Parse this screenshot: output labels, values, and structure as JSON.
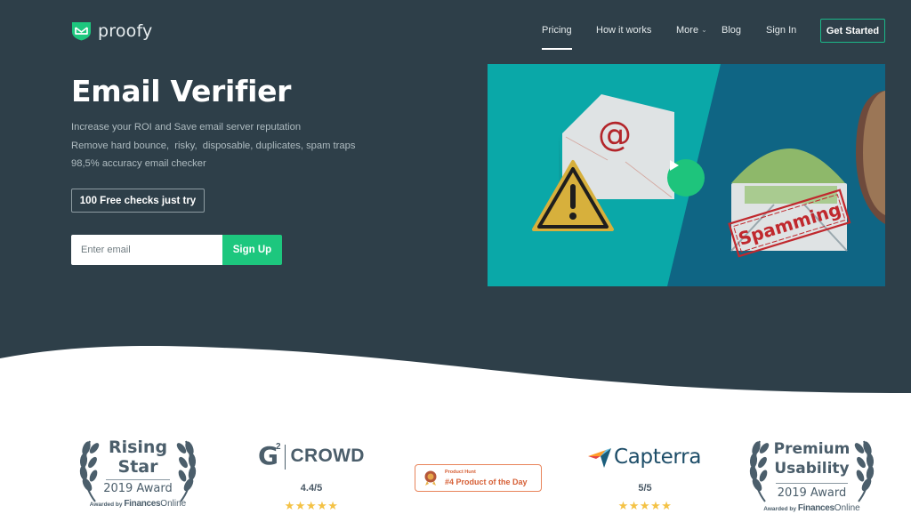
{
  "brand": {
    "name": "proofy",
    "accent": "#1dc77e",
    "hero_bg": "#2e3f49"
  },
  "nav": {
    "items": [
      {
        "label": "Pricing",
        "active": true
      },
      {
        "label": "How it works",
        "active": false
      },
      {
        "label": "More",
        "active": false,
        "has_dropdown": true
      },
      {
        "label": "Blog",
        "active": false
      },
      {
        "label": "Sign In",
        "active": false
      }
    ],
    "cta": "Get Started"
  },
  "hero": {
    "title": "Email Verifier",
    "lines": [
      "Increase your ROI and Save email server reputation",
      "Remove hard bounce,  risky,  disposable, duplicates, spam traps",
      "98,5% accuracy email checker"
    ],
    "free_checks_label": "100 Free checks just try",
    "email_placeholder": "Enter email",
    "email_value": "",
    "signup_label": "Sign Up"
  },
  "video": {
    "left_icon": "at-sign-envelope",
    "warning_icon": "warning-triangle",
    "stamp_text": "Spamming",
    "play_icon": "play-icon"
  },
  "awards": {
    "rising_star": {
      "title_line1": "Rising",
      "title_line2": "Star",
      "year": "2019 Award",
      "awarded_by": "Awarded by",
      "org_bold": "Finances",
      "org_light": "Online"
    },
    "g2crowd": {
      "logo_g": "G",
      "logo_sup": "2",
      "logo_text": "CROWD",
      "rating": "4.4/5",
      "stars": "★★★★★"
    },
    "product_hunt": {
      "small": "Product Hunt",
      "big": "#4 Product of the Day"
    },
    "capterra": {
      "logo_text": "Capterra",
      "rating": "5/5",
      "stars": "★★★★★"
    },
    "premium_usability": {
      "title_line1": "Premium",
      "title_line2": "Usability",
      "year": "2019 Award",
      "awarded_by": "Awarded by",
      "org_bold": "Finances",
      "org_light": "Online"
    }
  }
}
